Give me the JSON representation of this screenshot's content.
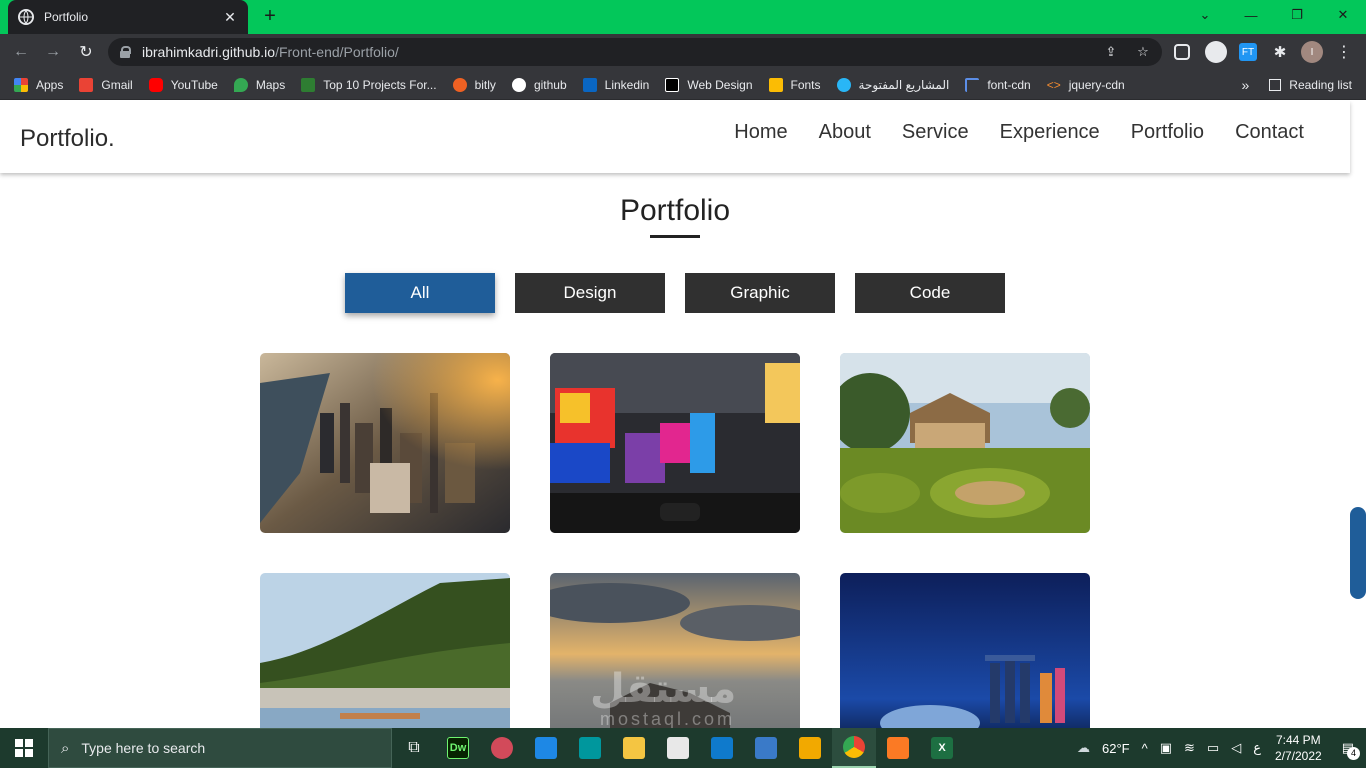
{
  "browser": {
    "tab_title": "Portfolio",
    "tab_close": "✕",
    "new_tab": "+",
    "url_host": "ibrahimkadri.github.io",
    "url_path": "/Front-end/Portfolio/",
    "profile_initial": "I",
    "ext_ft": "FT",
    "bookmarks": [
      {
        "label": "Apps",
        "color": "#ea4335"
      },
      {
        "label": "Gmail",
        "color": "#ea4335"
      },
      {
        "label": "YouTube",
        "color": "#ff0000"
      },
      {
        "label": "Maps",
        "color": "#34a853"
      },
      {
        "label": "Top 10 Projects For...",
        "color": "#2e7d32"
      },
      {
        "label": "bitly",
        "color": "#ee6123"
      },
      {
        "label": "github",
        "color": "#ffffff"
      },
      {
        "label": "Linkedin",
        "color": "#0a66c2"
      },
      {
        "label": "Web Design",
        "color": "#ffffff"
      },
      {
        "label": "Fonts",
        "color": "#fbbc04"
      },
      {
        "label": "المشاريع المفتوحة",
        "color": "#29b6f6"
      },
      {
        "label": "font-cdn",
        "color": "#5c8ee6"
      },
      {
        "label": "jquery-cdn",
        "color": "#f28b30"
      }
    ],
    "more_bookmarks": "»",
    "reading_list": "Reading list"
  },
  "site": {
    "logo": "Portfolio.",
    "nav": [
      "Home",
      "About",
      "Service",
      "Experience",
      "Portfolio",
      "Contact"
    ],
    "section_title": "Portfolio",
    "filters": [
      "All",
      "Design",
      "Graphic",
      "Code"
    ],
    "active_filter": "All",
    "accent_color": "#1f5d99",
    "gallery": [
      {
        "name": "city-aerial-photo"
      },
      {
        "name": "times-square-photo"
      },
      {
        "name": "garden-house-photo"
      },
      {
        "name": "hillside-town-photo"
      },
      {
        "name": "sunset-sea-photo"
      },
      {
        "name": "night-skyline-photo"
      }
    ],
    "watermark": "مستقل",
    "watermark_sub": "mostaql.com"
  },
  "taskbar": {
    "search_placeholder": "Type here to search",
    "weather": "62°F",
    "lang": "ع",
    "time": "7:44 PM",
    "date": "2/7/2022",
    "notifications": "4"
  }
}
